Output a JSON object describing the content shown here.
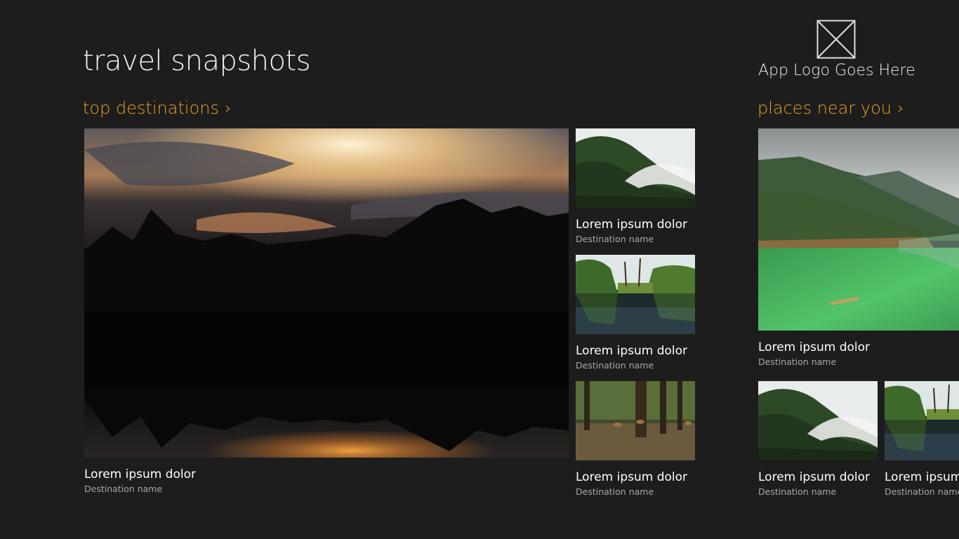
{
  "app": {
    "title": "travel snapshots",
    "logo_text": "App Logo Goes Here"
  },
  "sections": [
    {
      "header": "top destinations",
      "items": [
        {
          "title": "Lorem ipsum dolor",
          "subtitle": "Destination name"
        },
        {
          "title": "Lorem ipsum dolor",
          "subtitle": "Destination name"
        },
        {
          "title": "Lorem ipsum dolor",
          "subtitle": "Destination name"
        },
        {
          "title": "Lorem ipsum dolor",
          "subtitle": "Destination name"
        }
      ]
    },
    {
      "header": "places near you",
      "items": [
        {
          "title": "Lorem ipsum dolor",
          "subtitle": "Destination name"
        },
        {
          "title": "Lorem ipsum dolor",
          "subtitle": "Destination name"
        },
        {
          "title": "Lorem ipsum dolor",
          "subtitle": "Destination name"
        }
      ]
    }
  ],
  "colors": {
    "background": "#1d1d1d",
    "accent": "#e8a21f",
    "caption_subtitle": "#a8a8a8"
  },
  "icons": {
    "chevron": "›",
    "logo_placeholder": "crossed-box-icon"
  }
}
